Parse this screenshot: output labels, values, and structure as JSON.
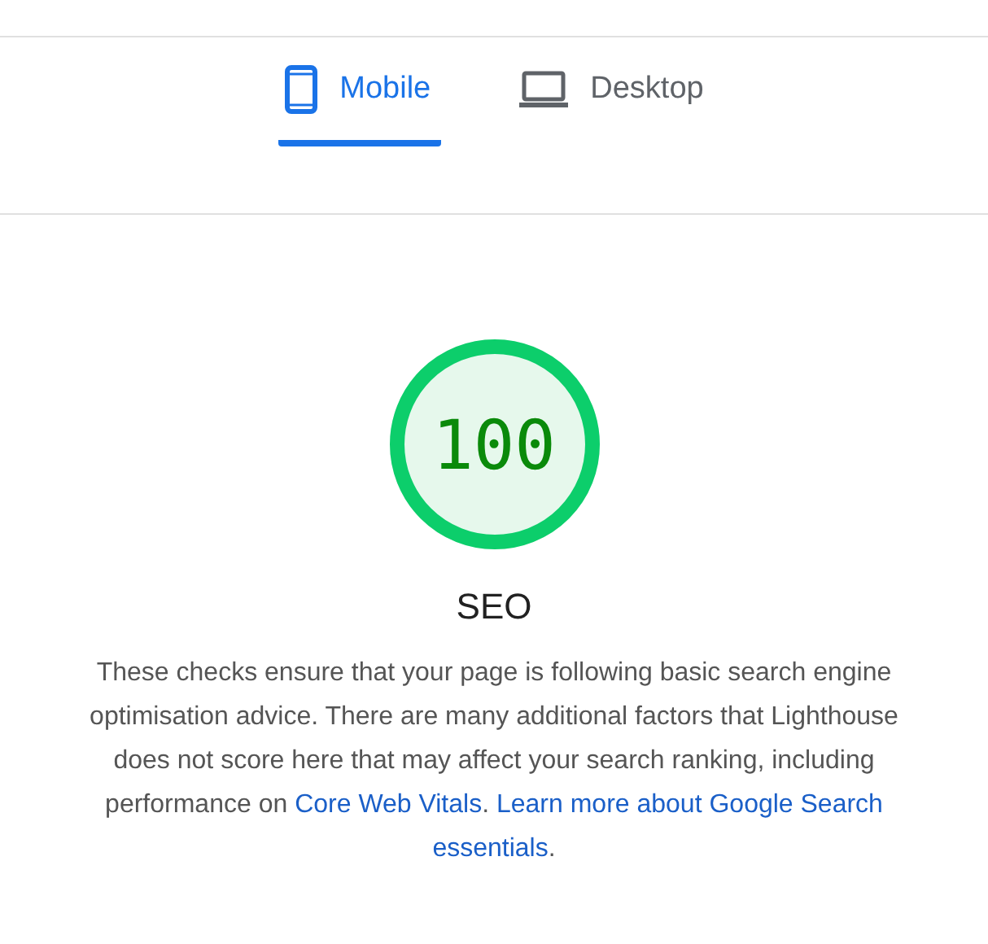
{
  "tabs": [
    {
      "label": "Mobile",
      "kind": "phone",
      "selected": true
    },
    {
      "label": "Desktop",
      "kind": "laptop",
      "selected": false
    }
  ],
  "score": {
    "value": "100"
  },
  "category": "SEO",
  "description": [
    {
      "kind": "text",
      "text": "These checks ensure that your page is following basic search engine optimisation advice. There are many additional factors that Lighthouse does not score here that may affect your search ranking, including performance on "
    },
    {
      "kind": "link",
      "text": "Core Web Vitals"
    },
    {
      "kind": "text",
      "text": ". "
    },
    {
      "kind": "link",
      "text": "Learn more about Google Search"
    },
    {
      "kind": "break"
    },
    {
      "kind": "link",
      "text": "essentials"
    },
    {
      "kind": "text",
      "text": "."
    }
  ]
}
